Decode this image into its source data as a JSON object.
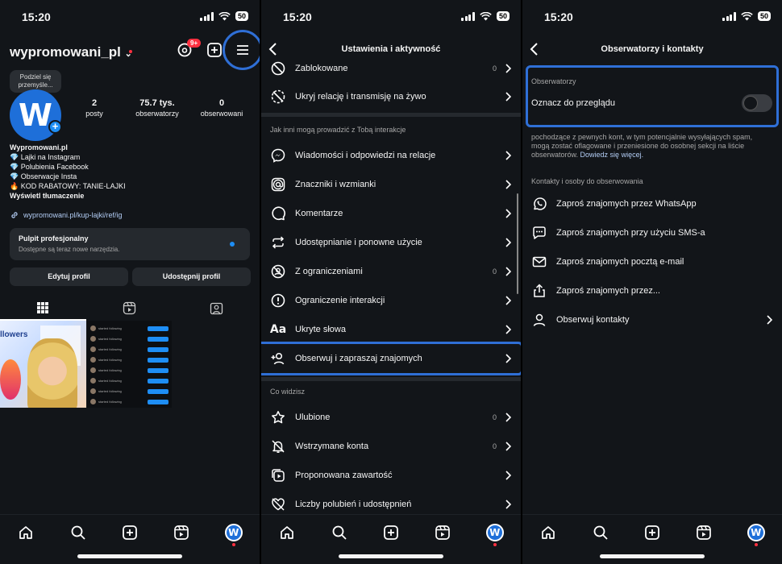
{
  "status_time": "15:20",
  "battery": "50",
  "profile": {
    "username": "wypromowani_pl",
    "threads_badge": "9+",
    "bubble_text": "Podziel się przemyśle...",
    "avatar_letter": "W",
    "stats": [
      {
        "value": "2",
        "label": "posty"
      },
      {
        "value": "75.7 tys.",
        "label": "obserwatorzy"
      },
      {
        "value": "0",
        "label": "obserwowani"
      }
    ],
    "bio_name": "Wypromowani.pl",
    "bio_lines": [
      "💎 Lajki na Instagram",
      "💎 Polubienia Facebook",
      "💎 Obserwacje Insta",
      "🔥 KOD RABATOWY: TANIE-LAJKI"
    ],
    "translate": "Wyświetl tłumaczenie",
    "link": "wypromowani.pl/kup-lajki/ref/ig",
    "pro_title": "Pulpit profesjonalny",
    "pro_sub": "Dostępne są teraz nowe narzędzia.",
    "edit_btn": "Edytuj profil",
    "share_btn": "Udostępnij profil",
    "thumb_word": "llowers"
  },
  "settings": {
    "title": "Ustawienia i aktywność",
    "top_items": [
      {
        "label": "Zablokowane",
        "count": "0"
      },
      {
        "label": "Ukryj relację i transmisję na żywo",
        "count": ""
      }
    ],
    "section1": "Jak inni mogą prowadzić z Tobą interakcje",
    "items1": [
      {
        "label": "Wiadomości i odpowiedzi na relacje",
        "count": ""
      },
      {
        "label": "Znaczniki i wzmianki",
        "count": ""
      },
      {
        "label": "Komentarze",
        "count": ""
      },
      {
        "label": "Udostępnianie i ponowne użycie",
        "count": ""
      },
      {
        "label": "Z ograniczeniami",
        "count": "0"
      },
      {
        "label": "Ograniczenie interakcji",
        "count": ""
      },
      {
        "label": "Ukryte słowa",
        "count": ""
      },
      {
        "label": "Obserwuj i zapraszaj znajomych",
        "count": ""
      }
    ],
    "section2": "Co widzisz",
    "items2": [
      {
        "label": "Ulubione",
        "count": "0"
      },
      {
        "label": "Wstrzymane konta",
        "count": "0"
      },
      {
        "label": "Proponowana zawartość",
        "count": ""
      },
      {
        "label": "Liczby polubień i udostępnień",
        "count": ""
      }
    ]
  },
  "followers": {
    "title": "Obserwatorzy i kontakty",
    "section1": "Obserwatorzy",
    "toggle_label": "Oznacz do przeglądu",
    "toggle_on": false,
    "desc_line1": "pochodzące z pewnych kont, w tym potencjalnie wysyłających spam,",
    "desc_line2": "mogą zostać oflagowane i przeniesione do osobnej sekcji na liście",
    "desc_line3": "obserwatorów.",
    "learn_more": "Dowiedz się więcej.",
    "section2": "Kontakty i osoby do obserwowania",
    "items": [
      {
        "label": "Zaproś znajomych przez WhatsApp"
      },
      {
        "label": "Zaproś znajomych przy użyciu SMS-a"
      },
      {
        "label": "Zaproś znajomych pocztą e-mail"
      },
      {
        "label": "Zaproś znajomych przez..."
      },
      {
        "label": "Obserwuj kontakty"
      }
    ]
  },
  "colors": {
    "highlight": "#2f6fd6",
    "accent": "#1e8ef5",
    "bg": "#121519"
  }
}
